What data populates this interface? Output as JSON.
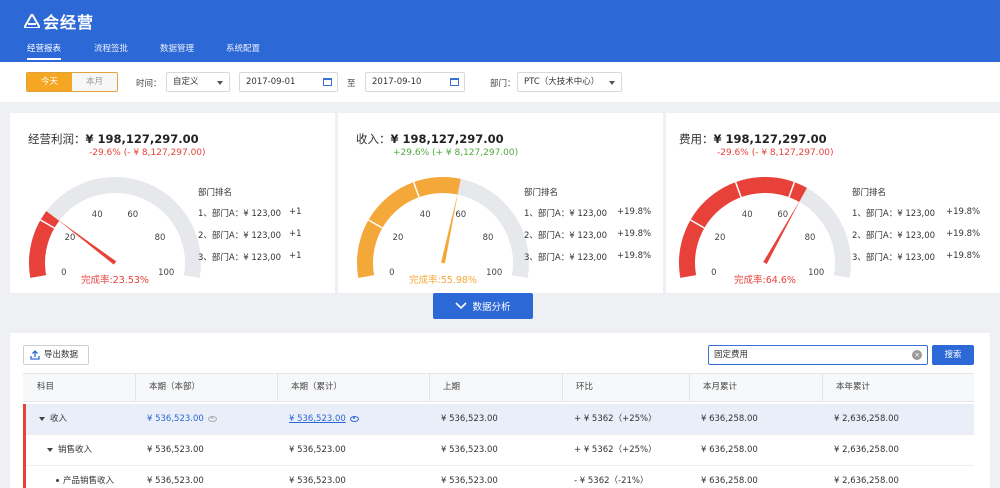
{
  "app": {
    "name": "会经营"
  },
  "nav": [
    {
      "label": "经营报表",
      "active": true
    },
    {
      "label": "流程签批",
      "active": false
    },
    {
      "label": "数据管理",
      "active": false
    },
    {
      "label": "系统配置",
      "active": false
    }
  ],
  "filter": {
    "today": "今天",
    "month": "本月",
    "time_label": "时间：",
    "time_value": "自定义",
    "date_from": "2017-09-01",
    "to_label": "至",
    "date_to": "2017-09-10",
    "dept_label": "部门：",
    "dept_value": "PTC（大技术中心）"
  },
  "cards": [
    {
      "title": "经营利润：",
      "amount": "¥ 198,127,297.00",
      "delta": "-29.6%  (- ¥ 8,127,297.00)",
      "delta_color": "#e8413a",
      "completion_label": "完成率:",
      "completion_value": "23.53%",
      "completion_fraction": 0.2353,
      "gauge_color": "#e8413a",
      "ticks": [
        "0",
        "20",
        "40",
        "60",
        "80",
        "100"
      ],
      "rank_title": "部门排名",
      "ranks": [
        {
          "name": "1、部门A：¥ 123,00",
          "change": "+1"
        },
        {
          "name": "2、部门A：¥ 123,00",
          "change": "+1"
        },
        {
          "name": "3、部门A：¥ 123,00",
          "change": "+1"
        }
      ]
    },
    {
      "title": "收入：",
      "amount": "¥ 198,127,297.00",
      "delta": "+29.6%  (+ ¥ 8,127,297.00)",
      "delta_color": "#4caa3b",
      "completion_label": "完成率:",
      "completion_value": "55.98%",
      "completion_fraction": 0.5598,
      "gauge_color": "#f5a83a",
      "ticks": [
        "0",
        "20",
        "40",
        "60",
        "80",
        "100"
      ],
      "rank_title": "部门排名",
      "ranks": [
        {
          "name": "1、部门A：¥ 123,00",
          "change": "+19.8%"
        },
        {
          "name": "2、部门A：¥ 123,00",
          "change": "+19.8%"
        },
        {
          "name": "3、部门A：¥ 123,00",
          "change": "+19.8%"
        }
      ]
    },
    {
      "title": "费用：",
      "amount": "¥ 198,127,297.00",
      "delta": "-29.6%  (- ¥ 8,127,297.00)",
      "delta_color": "#e8413a",
      "completion_label": "完成率:",
      "completion_value": "64.6%",
      "completion_fraction": 0.646,
      "gauge_color": "#e8413a",
      "ticks": [
        "0",
        "20",
        "40",
        "60",
        "80",
        "100"
      ],
      "rank_title": "部门排名",
      "ranks": [
        {
          "name": "1、部门A：¥ 123,00",
          "change": "+19.8%"
        },
        {
          "name": "2、部门A：¥ 123,00",
          "change": "+19.8%"
        },
        {
          "name": "3、部门A：¥ 123,00",
          "change": "+19.8%"
        }
      ]
    }
  ],
  "analysis_button": "数据分析",
  "table": {
    "export_label": "导出数据",
    "search_value": "固定费用",
    "search_button": "搜索",
    "columns": [
      "科目",
      "本期（本部）",
      "本期（累计）",
      "上期",
      "环比",
      "本月累计",
      "本年累计"
    ],
    "rows": [
      {
        "subject": "收入",
        "cur_dept": "¥ 536,523.00",
        "cur_total": "¥ 536,523.00",
        "prev": "¥ 536,523.00",
        "qoq": "+ ¥ 5362（+25%）",
        "month": "¥ 636,258.00",
        "year": "¥ 2,636,258.00"
      },
      {
        "subject": "销售收入",
        "cur_dept": "¥ 536,523.00",
        "cur_total": "¥ 536,523.00",
        "prev": "¥ 536,523.00",
        "qoq": "+ ¥ 5362（+25%）",
        "month": "¥ 636,258.00",
        "year": "¥ 2,636,258.00"
      },
      {
        "subject": "产品销售收入",
        "cur_dept": "¥ 536,523.00",
        "cur_total": "¥ 536,523.00",
        "prev": "¥ 536,523.00",
        "qoq": "- ¥ 5362（-21%）",
        "month": "¥ 636,258.00",
        "year": "¥ 2,636,258.00"
      }
    ]
  },
  "colors": {
    "primary": "#2c68d6",
    "accent": "#f5a623",
    "negative": "#e8413a",
    "positive": "#4caa3b"
  }
}
